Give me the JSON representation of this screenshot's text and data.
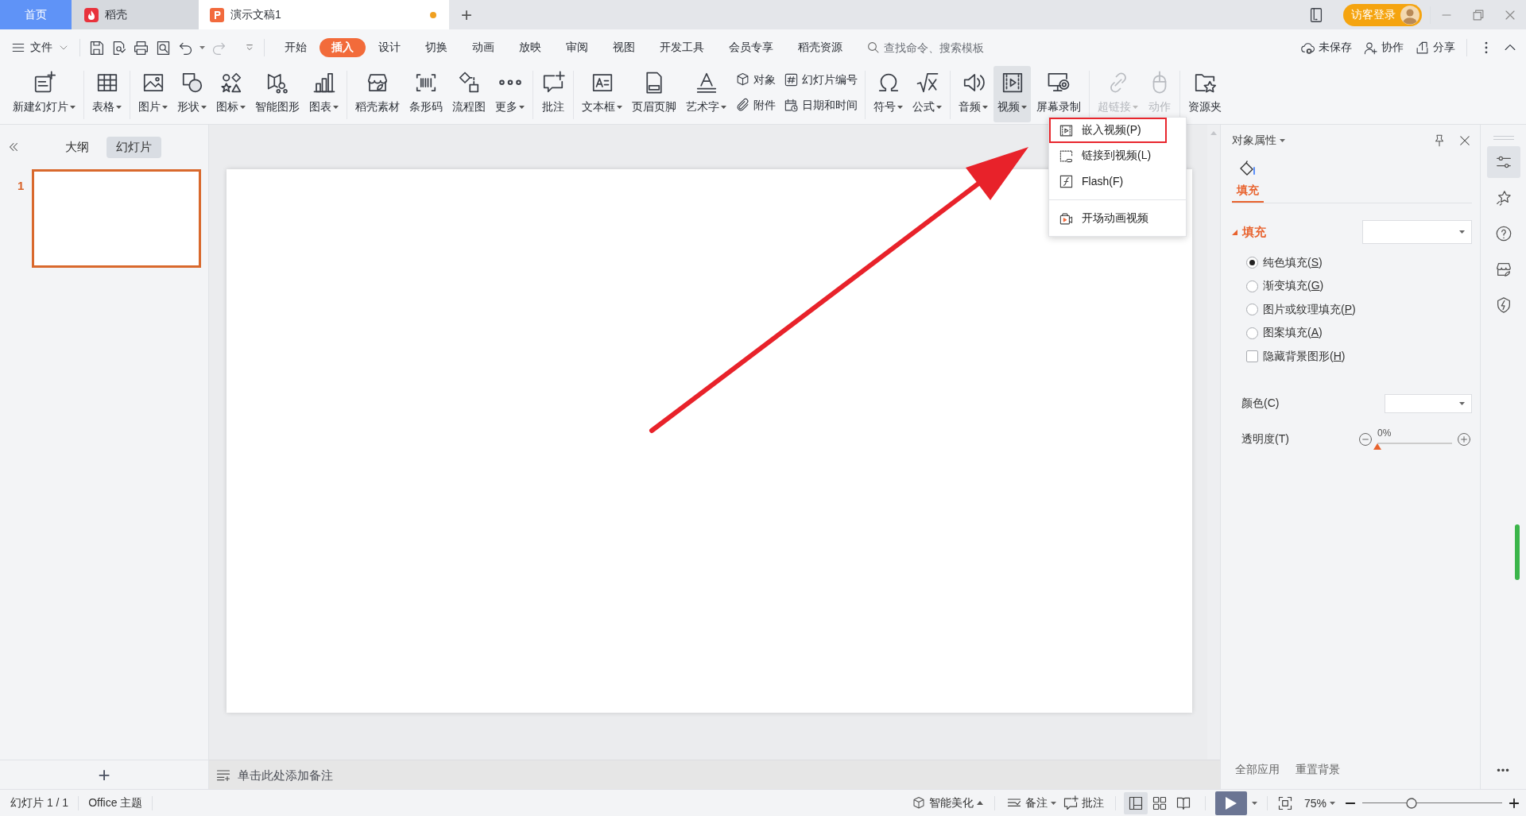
{
  "title_bar": {
    "tabs": [
      {
        "label": "首页",
        "kind": "home",
        "selected": false,
        "unsaved": false
      },
      {
        "label": "稻壳",
        "kind": "app",
        "selected": false,
        "unsaved": false
      },
      {
        "label": "演示文稿1",
        "kind": "document",
        "selected": true,
        "unsaved": true
      }
    ],
    "new_tab": "+",
    "login_button": "访客登录"
  },
  "menu_bar": {
    "file_menu": "文件",
    "tabs": [
      {
        "label": "开始",
        "selected": false
      },
      {
        "label": "插入",
        "selected": true
      },
      {
        "label": "设计",
        "selected": false
      },
      {
        "label": "切换",
        "selected": false
      },
      {
        "label": "动画",
        "selected": false
      },
      {
        "label": "放映",
        "selected": false
      },
      {
        "label": "审阅",
        "selected": false
      },
      {
        "label": "视图",
        "selected": false
      },
      {
        "label": "开发工具",
        "selected": false
      },
      {
        "label": "会员专享",
        "selected": false
      },
      {
        "label": "稻壳资源",
        "selected": false
      }
    ],
    "search": {
      "placeholder": "查找命令、搜索模板"
    },
    "actions": [
      "未保存",
      "协作",
      "分享"
    ]
  },
  "ribbon": {
    "groups": [
      {
        "items": [
          {
            "kind": "large",
            "label": "新建幻灯片",
            "dropdown": true,
            "disabled": false,
            "pressed": false
          }
        ]
      },
      {
        "items": [
          {
            "kind": "large",
            "label": "表格",
            "dropdown": true,
            "disabled": false,
            "pressed": false
          }
        ]
      },
      {
        "items": [
          {
            "kind": "large",
            "label": "图片",
            "dropdown": true,
            "disabled": false,
            "pressed": false
          },
          {
            "kind": "large",
            "label": "形状",
            "dropdown": true,
            "disabled": false,
            "pressed": false
          },
          {
            "kind": "large",
            "label": "图标",
            "dropdown": true,
            "disabled": false,
            "pressed": false
          },
          {
            "kind": "large",
            "label": "智能图形",
            "dropdown": false,
            "disabled": false,
            "pressed": false
          },
          {
            "kind": "large",
            "label": "图表",
            "dropdown": true,
            "disabled": false,
            "pressed": false
          }
        ]
      },
      {
        "items": [
          {
            "kind": "large",
            "label": "稻壳素材",
            "dropdown": false,
            "disabled": false,
            "pressed": false
          },
          {
            "kind": "large",
            "label": "条形码",
            "dropdown": false,
            "disabled": false,
            "pressed": false
          },
          {
            "kind": "large",
            "label": "流程图",
            "dropdown": false,
            "disabled": false,
            "pressed": false
          },
          {
            "kind": "large",
            "label": "更多",
            "dropdown": true,
            "disabled": false,
            "pressed": false
          }
        ]
      },
      {
        "items": [
          {
            "kind": "large",
            "label": "批注",
            "dropdown": false,
            "disabled": false,
            "pressed": false
          }
        ]
      },
      {
        "items": [
          {
            "kind": "large",
            "label": "文本框",
            "dropdown": true,
            "disabled": false,
            "pressed": false
          },
          {
            "kind": "large",
            "label": "页眉页脚",
            "dropdown": false,
            "disabled": false,
            "pressed": false
          },
          {
            "kind": "large",
            "label": "艺术字",
            "dropdown": true,
            "disabled": false,
            "pressed": false
          },
          {
            "kind": "stack",
            "items": [
              {
                "label": "对象",
                "disabled": false
              },
              {
                "label": "附件",
                "disabled": false
              }
            ]
          },
          {
            "kind": "stack",
            "items": [
              {
                "label": "幻灯片编号",
                "disabled": false
              },
              {
                "label": "日期和时间",
                "disabled": false
              }
            ]
          }
        ]
      },
      {
        "items": [
          {
            "kind": "large",
            "label": "符号",
            "dropdown": true,
            "disabled": false,
            "pressed": false
          },
          {
            "kind": "large",
            "label": "公式",
            "dropdown": true,
            "disabled": false,
            "pressed": false
          }
        ]
      },
      {
        "items": [
          {
            "kind": "large",
            "label": "音频",
            "dropdown": true,
            "disabled": false,
            "pressed": false
          },
          {
            "kind": "large",
            "label": "视频",
            "dropdown": true,
            "disabled": false,
            "pressed": true
          },
          {
            "kind": "large",
            "label": "屏幕录制",
            "dropdown": false,
            "disabled": false,
            "pressed": false
          }
        ]
      },
      {
        "items": [
          {
            "kind": "large",
            "label": "超链接",
            "dropdown": true,
            "disabled": true,
            "pressed": false
          },
          {
            "kind": "large",
            "label": "动作",
            "dropdown": false,
            "disabled": true,
            "pressed": false
          }
        ]
      },
      {
        "items": [
          {
            "kind": "large",
            "label": "资源夹",
            "dropdown": false,
            "disabled": false,
            "pressed": false
          }
        ]
      }
    ]
  },
  "dropdown_menu": {
    "items": [
      {
        "kind": "item",
        "label": "嵌入视频(P)",
        "highlighted": true
      },
      {
        "kind": "item",
        "label": "链接到视频(L)",
        "highlighted": false
      },
      {
        "kind": "item",
        "label": "Flash(F)",
        "highlighted": false
      },
      {
        "kind": "separator"
      },
      {
        "kind": "item",
        "label": "开场动画视频",
        "highlighted": false
      }
    ]
  },
  "annotation": {
    "kind": "arrow"
  },
  "left_panel": {
    "tabs": [
      {
        "label": "大纲",
        "selected": false
      },
      {
        "label": "幻灯片",
        "selected": true
      }
    ],
    "slides": [
      {
        "number": "1",
        "selected": true
      }
    ],
    "add_button": "+"
  },
  "notes": {
    "placeholder": "单击此处添加备注"
  },
  "properties_panel": {
    "title": "对象属性",
    "tabs": [
      {
        "label": "填充",
        "selected": true
      }
    ],
    "section": {
      "label": "填充",
      "expanded": true
    },
    "options": [
      {
        "kind": "radio",
        "label": "纯色填充(S)",
        "selected": true
      },
      {
        "kind": "radio",
        "label": "渐变填充(G)",
        "selected": false
      },
      {
        "kind": "radio",
        "label": "图片或纹理填充(P)",
        "selected": false
      },
      {
        "kind": "radio",
        "label": "图案填充(A)",
        "selected": false
      },
      {
        "kind": "checkbox",
        "label": "隐藏背景图形(H)",
        "checked": false
      }
    ],
    "color_label": "颜色(C)",
    "transparency": {
      "label": "透明度(T)",
      "reading": "0%",
      "level": 0
    },
    "buttons": [
      "全部应用",
      "重置背景"
    ]
  },
  "side_bar": {
    "items": [
      {
        "selected": true
      },
      {
        "selected": false
      },
      {
        "selected": false
      },
      {
        "selected": false
      },
      {
        "selected": false
      }
    ],
    "more": "•••"
  },
  "status_bar": {
    "slide_counter": "幻灯片 1 / 1",
    "theme": "Office 主题",
    "beautify": "智能美化",
    "notes": "备注",
    "comments": "批注",
    "views": [
      {
        "selected": true
      },
      {
        "selected": false
      },
      {
        "selected": false
      }
    ],
    "zoom": "75%",
    "zoom_slider": {
      "level": 0.35
    }
  }
}
